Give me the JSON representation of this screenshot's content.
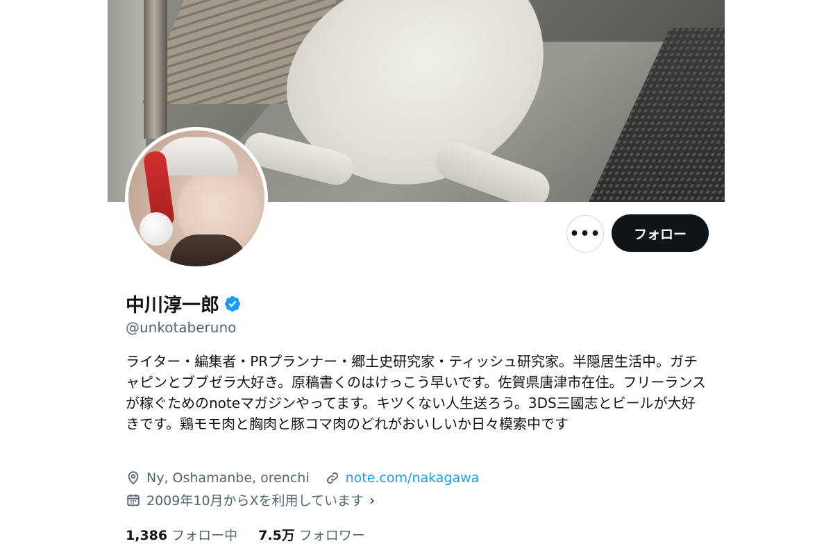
{
  "profile": {
    "display_name": "中川淳一郎",
    "handle": "@unkotaberuno",
    "bio": "ライター・編集者・PRプランナー・郷土史研究家・ティッシュ研究家。半隠居生活中。ガチャピンとブブゼラ大好き。原稿書くのはけっこう早いです。佐賀県唐津市在住。フリーランスが稼ぐためのnoteマガジンやってます。キツくない人生送ろう。3DS三國志とビールが大好きです。鶏モモ肉と胸肉と豚コマ肉のどれがおいしいか日々模索中です",
    "location": "Ny, Oshamanbe, orenchi",
    "website": "note.com/nakagawa",
    "joined": "2009年10月からXを利用しています",
    "verified": true
  },
  "actions": {
    "more_label": "•••",
    "follow_label": "フォロー"
  },
  "stats": {
    "following_count": "1,386",
    "following_label": "フォロー中",
    "followers_count": "7.5万",
    "followers_label": "フォロワー"
  },
  "icons": {
    "verified": "verified-badge-icon",
    "location": "location-pin-icon",
    "link": "link-icon",
    "calendar": "calendar-icon",
    "chevron": "chevron-right-icon"
  },
  "colors": {
    "accent": "#1d9bf0",
    "text": "#0f1419",
    "muted": "#536471",
    "follow_button": "#0f1419"
  }
}
